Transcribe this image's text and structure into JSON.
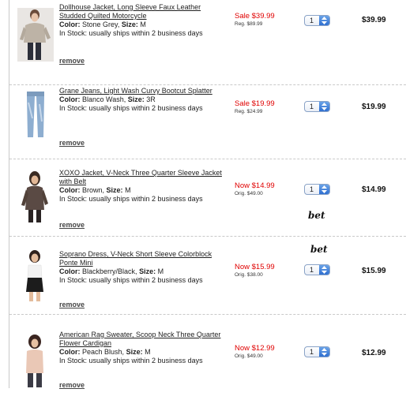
{
  "items": [
    {
      "name": "Dollhouse Jacket, Long Sleeve Faux Leather Studded Quilted Motorcycle",
      "color_label": "Color:",
      "color": "Stone Grey,",
      "size_label": "Size:",
      "size": "M",
      "stock": "In Stock: usually ships within 2 business days",
      "remove": "remove",
      "price_now": "Sale $39.99",
      "price_orig": "Reg. $89.99",
      "qty": "1",
      "total": "$39.99"
    },
    {
      "name": "Grane Jeans, Light Wash Curvy Bootcut Splatter",
      "color_label": "Color:",
      "color": "Blanco Wash,",
      "size_label": "Size:",
      "size": "3R",
      "stock": "In Stock: usually ships within 2 business days",
      "remove": "remove",
      "price_now": "Sale $19.99",
      "price_orig": "Reg. $24.99",
      "qty": "1",
      "total": "$19.99"
    },
    {
      "name": "XOXO Jacket, V-Neck Three Quarter Sleeve Jacket with Belt",
      "color_label": "Color:",
      "color": "Brown,",
      "size_label": "Size:",
      "size": "M",
      "stock": "In Stock: usually ships within 2 business days",
      "remove": "remove",
      "price_now": "Now $14.99",
      "price_orig": "Orig. $49.00",
      "qty": "1",
      "total": "$14.99"
    },
    {
      "name": "Soprano Dress, V-Neck Short Sleeve Colorblock Ponte Mini",
      "color_label": "Color:",
      "color": "Blackberry/Black,",
      "size_label": "Size:",
      "size": "M",
      "stock": "In Stock: usually ships within 2 business days",
      "remove": "remove",
      "price_now": "Now $15.99",
      "price_orig": "Orig. $38.00",
      "qty": "1",
      "total": "$15.99"
    },
    {
      "name": "American Rag Sweater, Scoop Neck Three Quarter Flower Cardigan",
      "color_label": "Color:",
      "color": "Peach Blush,",
      "size_label": "Size:",
      "size": "M",
      "stock": "In Stock: usually ships within 2 business days",
      "remove": "remove",
      "price_now": "Now $12.99",
      "price_orig": "Orig. $49.00",
      "qty": "1",
      "total": "$12.99"
    }
  ],
  "annotations": [
    "bet",
    "bet"
  ],
  "colors": {
    "sale": "#e00000",
    "separator": "#c9c9c9",
    "qty_arrow": "#2f6fd0"
  }
}
